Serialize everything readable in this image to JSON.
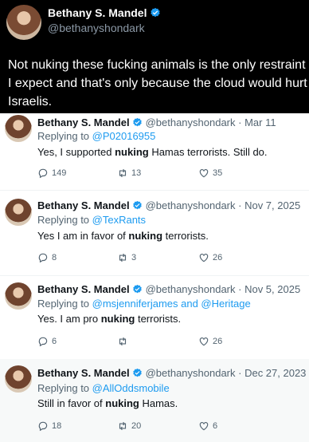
{
  "header_tweet": {
    "name": "Bethany S. Mandel",
    "handle": "@bethanyshondark",
    "body": "Not nuking these fucking animals is the only restraint I expect and that's only because the cloud would hurt Israelis."
  },
  "tweets": [
    {
      "name": "Bethany S. Mandel",
      "handle": "@bethanyshondark",
      "date": "· Mar 11",
      "replying_prefix": "Replying to ",
      "replying_to": "@P02016955",
      "text_before": "Yes, I supported ",
      "text_bold": "nuking",
      "text_after": " Hamas terrorists. Still do.",
      "replies": "149",
      "reposts": "13",
      "likes": "35"
    },
    {
      "name": "Bethany S. Mandel",
      "handle": "@bethanyshondark",
      "date": "· Nov 7, 2025",
      "replying_prefix": "Replying to ",
      "replying_to": "@TexRants",
      "text_before": "Yes I am in favor of ",
      "text_bold": "nuking",
      "text_after": " terrorists.",
      "replies": "8",
      "reposts": "3",
      "likes": "26"
    },
    {
      "name": "Bethany S. Mandel",
      "handle": "@bethanyshondark",
      "date": "· Nov 5, 2025",
      "replying_prefix": "Replying to ",
      "replying_to": "@msjenniferjames and @Heritage",
      "text_before": "Yes. I am pro ",
      "text_bold": "nuking",
      "text_after": " terrorists.",
      "replies": "6",
      "reposts": "",
      "likes": "26"
    },
    {
      "name": "Bethany S. Mandel",
      "handle": "@bethanyshondark",
      "date": "· Dec 27, 2023",
      "replying_prefix": "Replying to ",
      "replying_to": "@AllOddsmobile",
      "text_before": "Still in favor of ",
      "text_bold": "nuking",
      "text_after": " Hamas.",
      "replies": "18",
      "reposts": "20",
      "likes": "6"
    }
  ],
  "colors": {
    "accent": "#1d9bf0",
    "dark_bg": "#000000",
    "muted": "#536471"
  },
  "icons": {
    "verified": "verified-badge-icon",
    "reply": "reply-icon",
    "repost": "repost-icon",
    "like": "heart-icon"
  }
}
